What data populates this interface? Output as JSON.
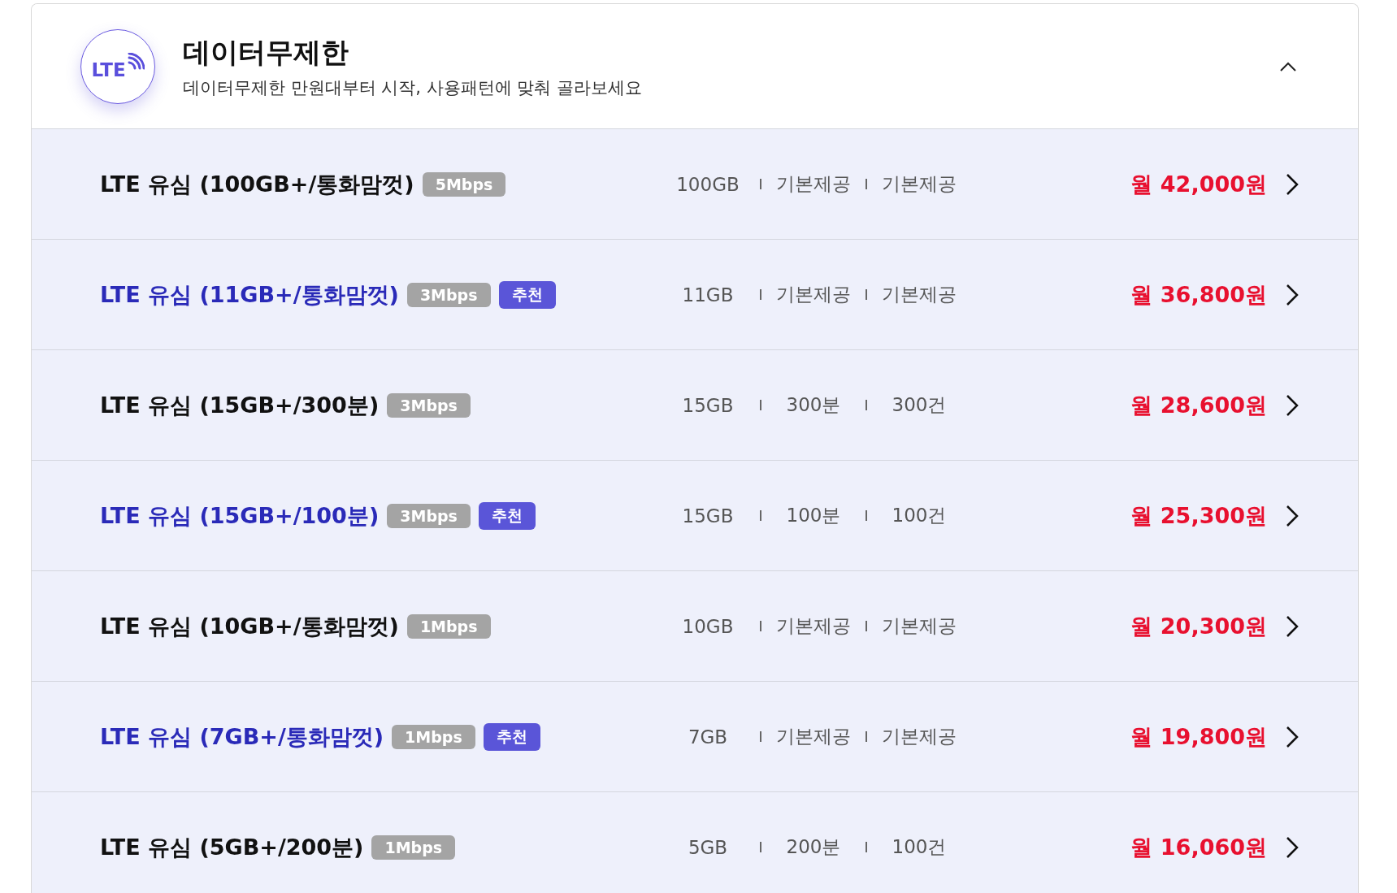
{
  "header": {
    "icon_text": "LTE",
    "title": "데이터무제한",
    "subtitle": "데이터무제한 만원대부터 시작, 사용패턴에 맞춰 골라보세요",
    "expanded": true
  },
  "plans": [
    {
      "name": "LTE 유심 (100GB+/통화맘껏)",
      "speed": "5Mbps",
      "highlighted": false,
      "data": "100GB",
      "voice": "기본제공",
      "sms": "기본제공",
      "price": "월 42,000원"
    },
    {
      "name": "LTE 유심 (11GB+/통화맘껏)",
      "speed": "3Mbps",
      "badge": "추천",
      "highlighted": true,
      "data": "11GB",
      "voice": "기본제공",
      "sms": "기본제공",
      "price": "월 36,800원"
    },
    {
      "name": "LTE 유심 (15GB+/300분)",
      "speed": "3Mbps",
      "highlighted": false,
      "data": "15GB",
      "voice": "300분",
      "sms": "300건",
      "price": "월 28,600원"
    },
    {
      "name": "LTE 유심 (15GB+/100분)",
      "speed": "3Mbps",
      "badge": "추천",
      "highlighted": true,
      "data": "15GB",
      "voice": "100분",
      "sms": "100건",
      "price": "월 25,300원"
    },
    {
      "name": "LTE 유심 (10GB+/통화맘껏)",
      "speed": "1Mbps",
      "highlighted": false,
      "data": "10GB",
      "voice": "기본제공",
      "sms": "기본제공",
      "price": "월 20,300원"
    },
    {
      "name": "LTE 유심 (7GB+/통화맘껏)",
      "speed": "1Mbps",
      "badge": "추천",
      "highlighted": true,
      "data": "7GB",
      "voice": "기본제공",
      "sms": "기본제공",
      "price": "월 19,800원"
    },
    {
      "name": "LTE 유심 (5GB+/200분)",
      "speed": "1Mbps",
      "highlighted": false,
      "data": "5GB",
      "voice": "200분",
      "sms": "100건",
      "price": "월 16,060원"
    }
  ]
}
